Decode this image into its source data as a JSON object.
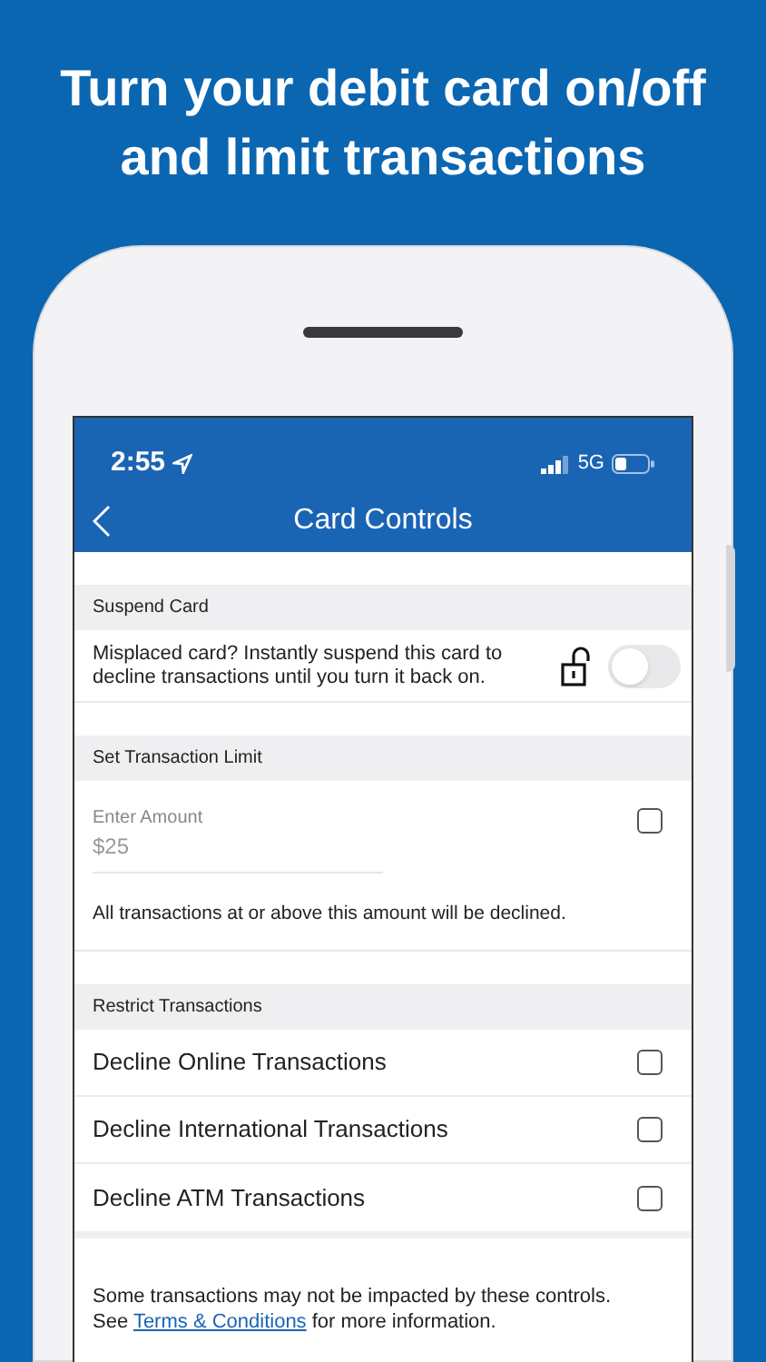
{
  "headline": "Turn your debit card on/off and limit transactions",
  "status_bar": {
    "time": "2:55",
    "network": "5G"
  },
  "nav": {
    "title": "Card Controls"
  },
  "suspend": {
    "header": "Suspend Card",
    "text": "Misplaced card? Instantly suspend this card to decline transactions until you turn it back on.",
    "on": false
  },
  "limit": {
    "header": "Set Transaction Limit",
    "label": "Enter Amount",
    "placeholder": "$25",
    "checked": false,
    "note": "All transactions at or above this amount will be declined."
  },
  "restrict": {
    "header": "Restrict Transactions",
    "items": [
      {
        "label": "Decline Online Transactions",
        "checked": false
      },
      {
        "label": "Decline International Transactions",
        "checked": false
      },
      {
        "label": "Decline ATM Transactions",
        "checked": false
      }
    ]
  },
  "footer": {
    "before": "Some transactions may not be impacted by these controls. See",
    "link": "Terms & Conditions",
    "after": "for more information."
  }
}
